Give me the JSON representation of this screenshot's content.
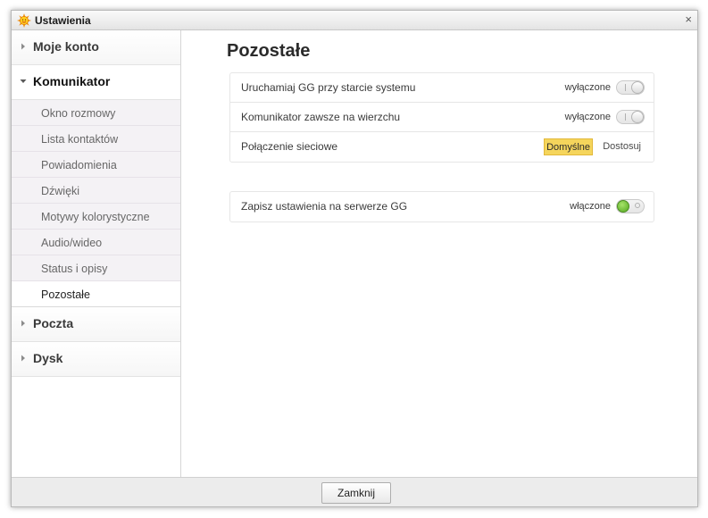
{
  "window": {
    "title": "Ustawienia",
    "close_glyph": "×"
  },
  "sidebar": {
    "sections": [
      {
        "label": "Moje konto",
        "expanded": false
      },
      {
        "label": "Komunikator",
        "expanded": true
      },
      {
        "label": "Poczta",
        "expanded": false
      },
      {
        "label": "Dysk",
        "expanded": false
      }
    ],
    "komunikator_items": [
      {
        "label": "Okno rozmowy",
        "active": false
      },
      {
        "label": "Lista kontaktów",
        "active": false
      },
      {
        "label": "Powiadomienia",
        "active": false
      },
      {
        "label": "Dźwięki",
        "active": false
      },
      {
        "label": "Motywy kolorystyczne",
        "active": false
      },
      {
        "label": "Audio/wideo",
        "active": false
      },
      {
        "label": "Status i opisy",
        "active": false
      },
      {
        "label": "Pozostałe",
        "active": true
      }
    ]
  },
  "main": {
    "title": "Pozostałe",
    "group1": {
      "rows": [
        {
          "label": "Uruchamiaj GG przy starcie systemu",
          "state": "wyłączone",
          "on": false
        },
        {
          "label": "Komunikator zawsze na wierzchu",
          "state": "wyłączone",
          "on": false
        },
        {
          "label": "Połączenie sieciowe",
          "options": [
            "Domyślne",
            "Dostosuj"
          ],
          "selected": "Domyślne"
        }
      ]
    },
    "group2": {
      "rows": [
        {
          "label": "Zapisz ustawienia na serwerze GG",
          "state": "włączone",
          "on": true
        }
      ]
    }
  },
  "footer": {
    "close_label": "Zamknij"
  },
  "colors": {
    "accent_selected": "#f5d55c",
    "toggle_on": "#53a81f"
  },
  "icons": {
    "app": "gg-sun-icon",
    "section_arrow": "chevron-right-icon",
    "section_arrow_open": "chevron-down-icon"
  }
}
